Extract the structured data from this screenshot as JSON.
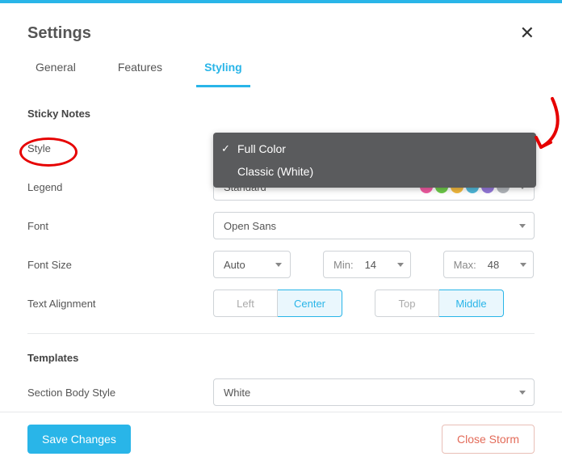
{
  "title": "Settings",
  "tabs": [
    "General",
    "Features",
    "Styling"
  ],
  "activeTab": 2,
  "stickyNotes": {
    "heading": "Sticky Notes",
    "style": {
      "label": "Style",
      "options": [
        "Full Color",
        "Classic (White)"
      ],
      "selectedIndex": 0
    },
    "legend": {
      "label": "Legend",
      "value": "Standard",
      "dots": [
        "#ef5aa0",
        "#6ec94a",
        "#f2b93e",
        "#4fb7d8",
        "#9478d9",
        "#b2b6bb"
      ]
    },
    "font": {
      "label": "Font",
      "value": "Open Sans"
    },
    "fontSize": {
      "label": "Font Size",
      "auto": "Auto",
      "minLabel": "Min:",
      "minValue": "14",
      "maxLabel": "Max:",
      "maxValue": "48"
    },
    "alignment": {
      "label": "Text Alignment",
      "horiz": {
        "left": "Left",
        "center": "Center",
        "active": "center"
      },
      "vert": {
        "top": "Top",
        "middle": "Middle",
        "active": "middle"
      }
    }
  },
  "templates": {
    "heading": "Templates",
    "sectionBodyStyle": {
      "label": "Section Body Style",
      "value": "White"
    }
  },
  "footer": {
    "save": "Save Changes",
    "closeStorm": "Close Storm"
  }
}
